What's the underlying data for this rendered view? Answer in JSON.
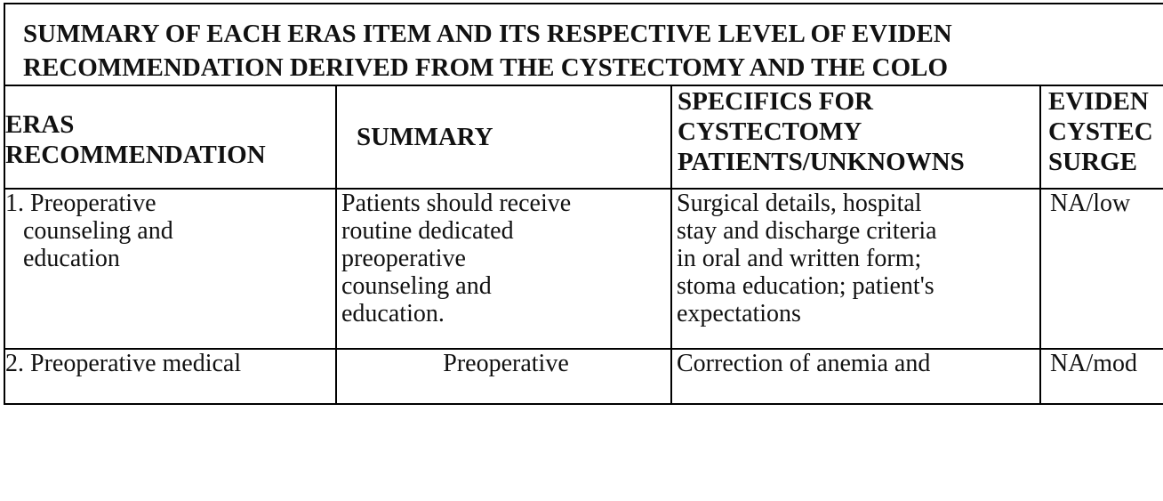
{
  "title": {
    "line1": "SUMMARY OF EACH ERAS ITEM AND ITS RESPECTIVE LEVEL OF EVIDEN",
    "line2": "RECOMMENDATION DERIVED FROM THE CYSTECTOMY AND THE COLO"
  },
  "headers": {
    "col1": [
      "ERAS",
      "RECOMMENDATION"
    ],
    "col2": [
      "SUMMARY"
    ],
    "col3": [
      "SPECIFICS FOR",
      "CYSTECTOMY",
      "PATIENTS/UNKNOWNS"
    ],
    "col4": [
      "EVIDEN",
      "CYSTEC",
      "SURGE"
    ]
  },
  "rows": [
    {
      "recommendation": [
        "1. Preoperative",
        "counseling and",
        "education"
      ],
      "summary": [
        "Patients should receive",
        "routine dedicated",
        "preoperative",
        "counseling and",
        "education."
      ],
      "specifics": [
        "Surgical details, hospital",
        "stay and discharge criteria",
        "in oral and written form;",
        "stoma education; patient's",
        "expectations"
      ],
      "evidence": "NA/low"
    },
    {
      "recommendation": [
        "2. Preoperative medical"
      ],
      "summary": [
        "Preoperative"
      ],
      "specifics": [
        "Correction of anemia and"
      ],
      "evidence": "NA/mod"
    }
  ]
}
